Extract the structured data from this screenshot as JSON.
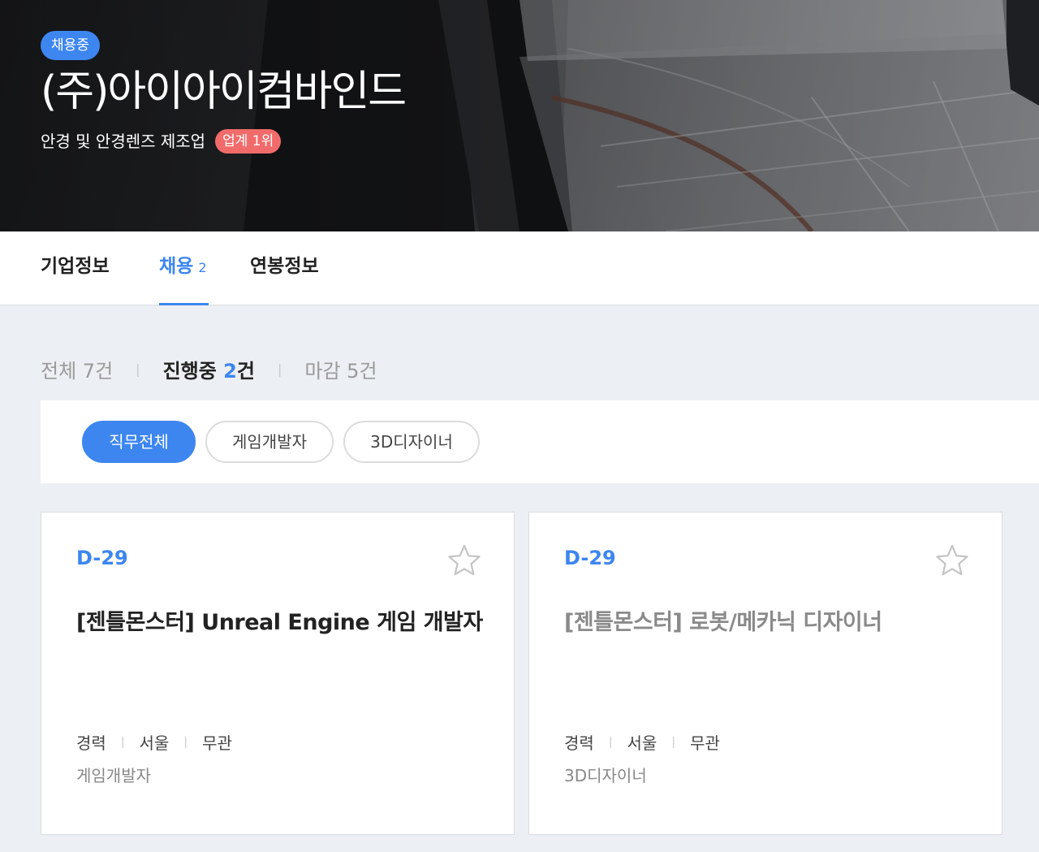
{
  "hero": {
    "status_badge": "채용중",
    "company_name": "(주)아이아이컴바인드",
    "industry": "안경 및 안경렌즈 제조업",
    "rank_badge": "업계 1위"
  },
  "tabs": [
    {
      "label": "기업정보",
      "count": "",
      "active": false
    },
    {
      "label": "채용",
      "count": "2",
      "active": true
    },
    {
      "label": "연봉정보",
      "count": "",
      "active": false
    }
  ],
  "status_filter": {
    "all": {
      "label": "전체 ",
      "count": "7",
      "suffix": "건"
    },
    "ongoing": {
      "label": "진행중 ",
      "count": "2",
      "suffix": "건"
    },
    "closed": {
      "label": "마감 ",
      "count": "5",
      "suffix": "건"
    }
  },
  "job_filters": [
    {
      "label": "직무전체",
      "active": true
    },
    {
      "label": "게임개발자",
      "active": false
    },
    {
      "label": "3D디자이너",
      "active": false
    }
  ],
  "jobs": [
    {
      "dday": "D-29",
      "title": "[젠틀몬스터] Unreal Engine 게임 개발자",
      "career": "경력",
      "location": "서울",
      "education": "무관",
      "category": "게임개발자",
      "bookmark_icon": "star-outline-icon"
    },
    {
      "dday": "D-29",
      "title": "[젠틀몬스터] 로봇/메카닉 디자이너",
      "career": "경력",
      "location": "서울",
      "education": "무관",
      "category": "3D디자이너",
      "bookmark_icon": "star-outline-icon"
    }
  ],
  "colors": {
    "accent": "#3d86f0",
    "rank_badge": "#f26b6b",
    "page_bg": "#eceff3"
  }
}
